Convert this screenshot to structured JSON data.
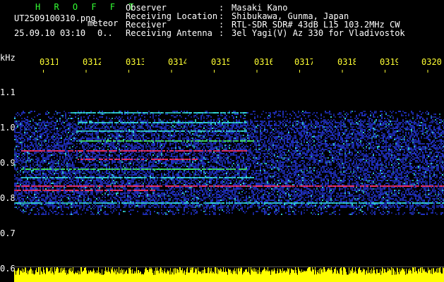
{
  "header": {
    "app_name": "H R O F F T",
    "file_name": "UT2509100310.png",
    "mode": "meteor",
    "datetime": "25.09.10 03:10",
    "count": "0..",
    "info": [
      {
        "label": "Observer",
        "value": "Masaki Kano"
      },
      {
        "label": "Receiving Location",
        "value": "Shibukawa, Gunma, Japan"
      },
      {
        "label": "Receiver",
        "value": "RTL-SDR SDR# 43dB L15 103.2MHz CW"
      },
      {
        "label": "Receiving Antenna",
        "value": "3el Yagi(V) Az 330 for Vladivostok"
      }
    ],
    "separator": ":"
  },
  "axes": {
    "unit": "kHz",
    "time_ticks": [
      "0311",
      "0312",
      "0313",
      "0314",
      "0315",
      "0316",
      "0317",
      "0318",
      "0319",
      "0320"
    ],
    "freq_ticks": [
      "1.1",
      "1.0",
      "0.9",
      "0.8",
      "0.7",
      "0.6"
    ]
  },
  "colors": {
    "background": "#000000",
    "label_white": "#ffffff",
    "label_yellow": "#ffff33",
    "title_green": "#33ff33",
    "noise_blue": "#2233cc",
    "signal_cyan": "#33dddd",
    "signal_green": "#44ee66",
    "signal_red": "#ff3366",
    "amplitude_yellow": "#ffff00"
  }
}
